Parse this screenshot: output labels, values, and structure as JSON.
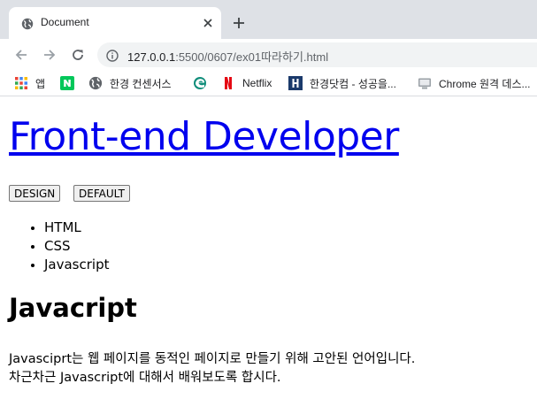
{
  "browser": {
    "tab": {
      "title": "Document",
      "favicon": "globe-icon"
    },
    "new_tab_label": "+",
    "address": {
      "host": "127.0.0.1",
      "path": ":5500/0607/ex01따라하기.html"
    },
    "bookmarks": [
      {
        "label": "앱",
        "icon": "apps-grid-icon"
      },
      {
        "label": "",
        "icon": "naver-n-icon"
      },
      {
        "label": "한경 컨센서스",
        "icon": "globe-icon"
      },
      {
        "label": "",
        "icon": "edge-icon"
      },
      {
        "label": "Netflix",
        "icon": "netflix-icon"
      },
      {
        "label": "한경닷컴 - 성공을...",
        "icon": "h-logo-icon"
      },
      {
        "label": "Chrome 원격 데스...",
        "icon": "remote-desktop-icon"
      }
    ]
  },
  "page": {
    "title": "Front-end Developer",
    "buttons": [
      "DESIGN",
      "DEFAULT"
    ],
    "list": [
      "HTML",
      "CSS",
      "Javascript"
    ],
    "heading": "Javacript",
    "paragraph": [
      "Javasciprt는 웹 페이지를 동적인 페이지로 만들기 위해 고안된 언어입니다.",
      "차근차근 Javascript에 대해서 배워보도록 합시다."
    ]
  },
  "colors": {
    "tabstrip_bg": "#dee1e6",
    "omnibox_bg": "#f1f3f4",
    "link": "#0000ee",
    "naver_green": "#03c75a",
    "netflix_red": "#e50914",
    "hk_navy": "#1b3a6b"
  }
}
